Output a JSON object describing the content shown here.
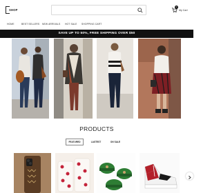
{
  "header": {
    "logo_text": "SHOP",
    "search_placeholder": "",
    "cart_count": "0",
    "cart_label": "My Cart"
  },
  "nav": {
    "items": [
      "HOME",
      "BEST SELLERS",
      "NEW ARRIVALS",
      "HOT SALE",
      "SHOPPING CART"
    ]
  },
  "promo": {
    "text": "SAVE UP TO 50%, FREE SHIPPING OVER $50"
  },
  "products": {
    "title": "PRODUCTS",
    "tabs": [
      "FEATURED",
      "LASTEST",
      "ON SALE"
    ],
    "active_tab": "FEATURED"
  },
  "icons": {
    "search": "search-icon",
    "cart": "cart-icon",
    "next": "chevron-right-icon"
  },
  "colors": {
    "promo_bg": "#111111",
    "text": "#222222"
  }
}
